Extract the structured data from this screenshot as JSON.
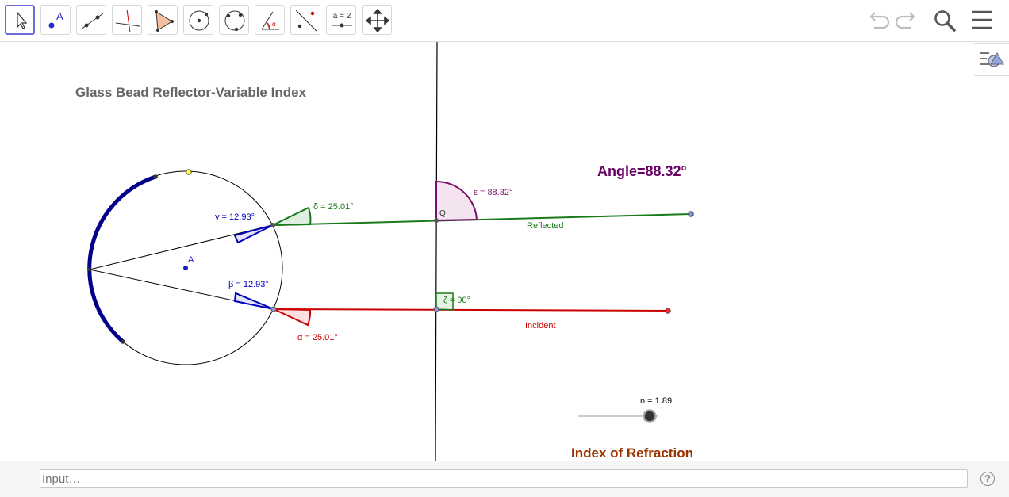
{
  "toolbar": {
    "tools": [
      {
        "icon": "move-arrow-icon"
      },
      {
        "icon": "point-icon",
        "label": "A"
      },
      {
        "icon": "line-icon"
      },
      {
        "icon": "perpendicular-line-icon"
      },
      {
        "icon": "polygon-icon"
      },
      {
        "icon": "circle-center-point-icon"
      },
      {
        "icon": "circle-three-points-icon"
      },
      {
        "icon": "angle-icon",
        "label": "α"
      },
      {
        "icon": "reflect-icon"
      },
      {
        "icon": "slider-icon",
        "label": "a = 2"
      },
      {
        "icon": "move-graphics-view-icon"
      }
    ],
    "right_icons": [
      "undo-icon",
      "redo-icon",
      "search-icon",
      "menu-icon"
    ]
  },
  "canvas": {
    "title": "Glass Bead Reflector-Variable Index",
    "angle_display": "Angle=88.32°",
    "label_A": "A",
    "label_Q": "Q",
    "reflected": "Reflected",
    "incident": "Incident",
    "angles": {
      "delta": "δ = 25.01°",
      "gamma": "γ = 12.93°",
      "beta": "β = 12.93°",
      "alpha": "α = 25.01°",
      "epsilon": "ε = 88.32°",
      "zeta": "ζ = 90°"
    },
    "slider": {
      "label": "n = 1.89",
      "value": 1.89
    },
    "index_caption": "Index of Refraction"
  },
  "colors": {
    "reflected": "#1a7a1a",
    "incident": "#cc0000",
    "arc": "#00008b",
    "epsilon": "#7b0f6b",
    "index_caption": "#993300",
    "angle_title": "#660066"
  },
  "input": {
    "placeholder": "Input…"
  },
  "help_symbol": "?"
}
